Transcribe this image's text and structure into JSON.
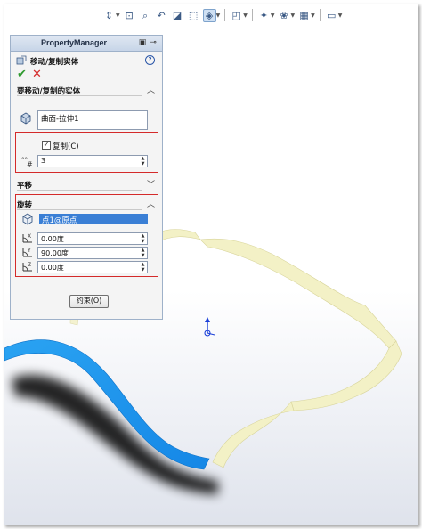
{
  "colors": {
    "blue_surface": "#1f9bf0",
    "yellow_surface": "#f3f1c6",
    "highlight_box": "#d42a2a",
    "selection": "#3a7fd5"
  },
  "toolbar": {
    "icons": [
      "view-orientation-icon",
      "zoom-fit-icon",
      "zoom-area-icon",
      "previous-view-icon",
      "section-view-icon",
      "view-cube-icon",
      "display-style-icon",
      "hide-show-icon",
      "edit-appearance-icon",
      "apply-scene-icon",
      "view-settings-icon",
      "display-pane-icon"
    ]
  },
  "property_manager": {
    "title": "PropertyManager",
    "feature_name": "移动/复制实体",
    "help": "?",
    "ok": "✔",
    "cancel": "✕",
    "bodies_section": {
      "label": "要移动/复制的实体",
      "selected_body": "曲面-拉伸1"
    },
    "copy": {
      "label": "复制(C)",
      "checked": true,
      "count": "3"
    },
    "translate_section": {
      "label": "平移"
    },
    "rotate_section": {
      "label": "旋转",
      "origin": "点1@原点",
      "x_angle": "0.00度",
      "y_angle": "90.00度",
      "z_angle": "0.00度"
    },
    "constraints_button": "约束(O)"
  }
}
